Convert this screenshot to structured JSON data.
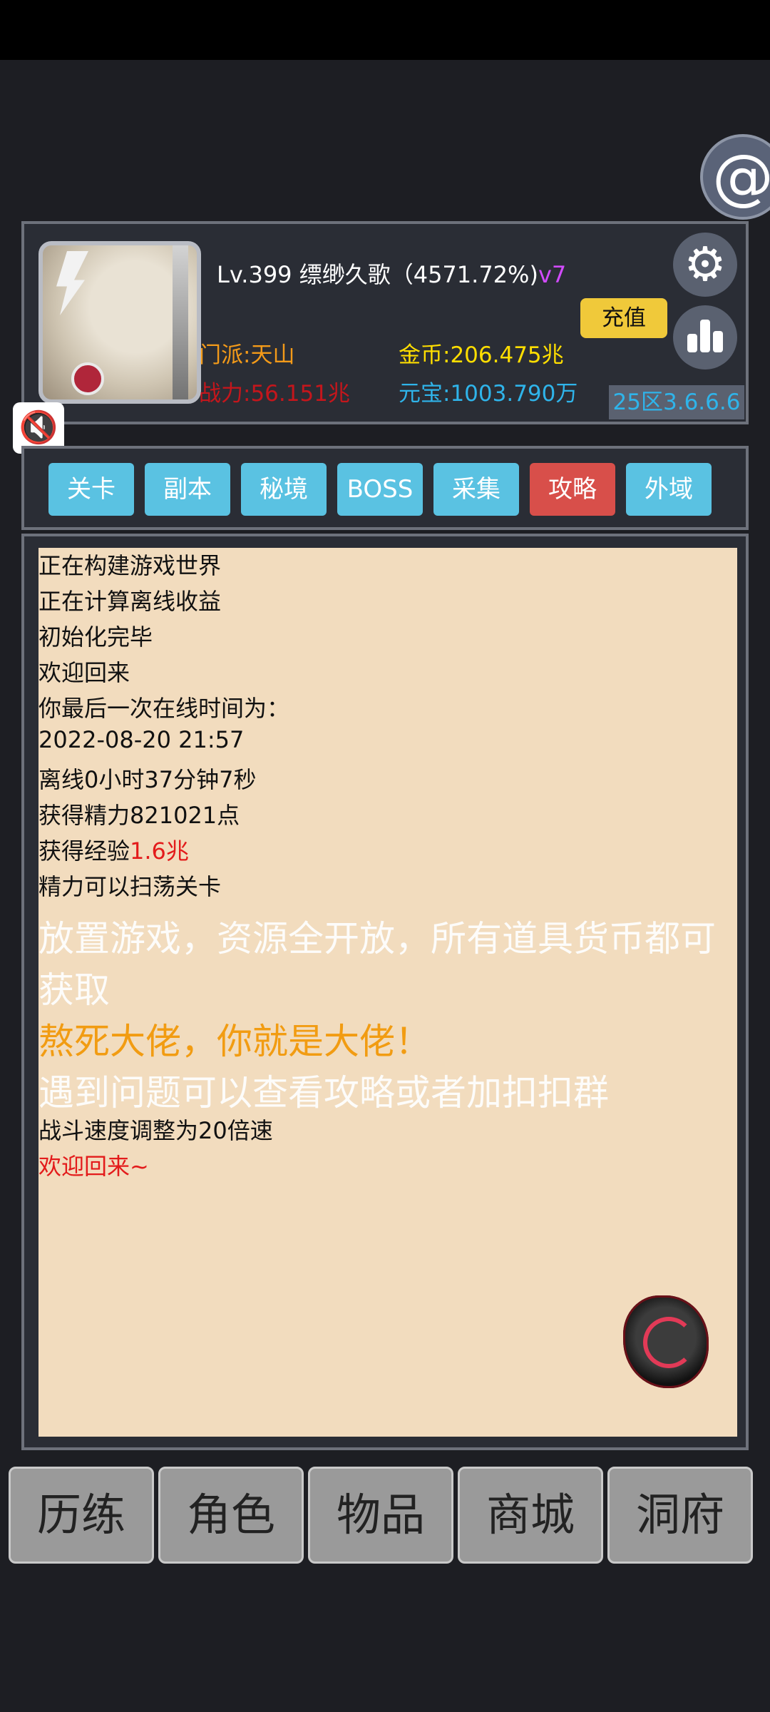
{
  "player": {
    "level_name": "Lv.399 缥缈久歌（4571.72%)",
    "vip": "v7",
    "sect": "门派:天山",
    "power": "战力:56.151兆",
    "gold": "金币:206.475兆",
    "yuanbao": "元宝:1003.790万"
  },
  "header": {
    "recharge_label": "充值",
    "server": "25区3.6.6.6",
    "at_symbol": "@",
    "gear_symbol": "⚙",
    "mute_symbol": "🔇"
  },
  "tabs": [
    {
      "label": "关卡"
    },
    {
      "label": "副本"
    },
    {
      "label": "秘境"
    },
    {
      "label": "BOSS"
    },
    {
      "label": "采集"
    },
    {
      "label": "攻略",
      "active": true
    },
    {
      "label": "外域"
    }
  ],
  "log": {
    "lines": [
      "正在构建游戏世界",
      "正在计算离线收益",
      "初始化完毕",
      "欢迎回来",
      "你最后一次在线时间为：",
      "2022-08-20 21:57",
      "离线0小时37分钟7秒",
      "获得精力821021点"
    ],
    "exp_prefix": "获得经验",
    "exp_value": "1.6兆",
    "sweep": "精力可以扫荡关卡",
    "big1a": "放置游戏，资源全开放，所有道具货币都可",
    "big1b": "获取",
    "big2": "熬死大佬，你就是大佬！",
    "big3": "遇到问题可以查看攻略或者加扣扣群",
    "speed": "战斗速度调整为20倍速",
    "welcome": "欢迎回来~"
  },
  "nav": [
    {
      "label": "历练"
    },
    {
      "label": "角色"
    },
    {
      "label": "物品"
    },
    {
      "label": "商城"
    },
    {
      "label": "洞府"
    }
  ],
  "colors": {
    "background": "#1d1e23",
    "tab": "#5ac2e2",
    "tab_active": "#d84f4a",
    "log_bg": "#f2dcbe",
    "gold": "#ffde00",
    "yuanbao": "#2fb4ea",
    "sect": "#f39a19",
    "power": "#c4161c",
    "vip": "#d24bff"
  }
}
